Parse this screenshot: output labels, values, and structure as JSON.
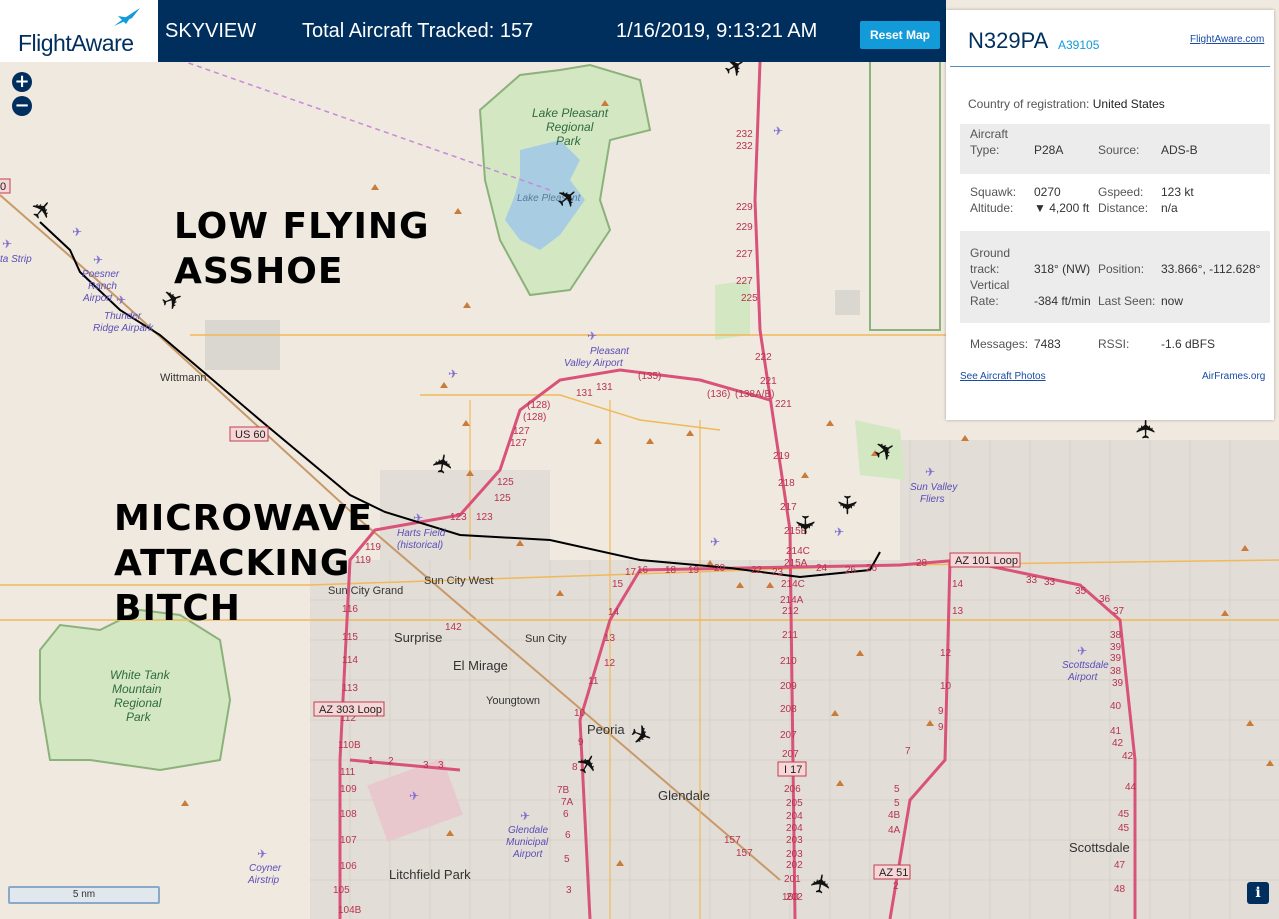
{
  "header": {
    "logo": "FlightAware",
    "title": "SKYVIEW",
    "aircraft_count": "Total Aircraft Tracked: 157",
    "datetime": "1/16/2019, 9:13:21 AM",
    "reset_label": "Reset Map"
  },
  "zoom": {
    "in": "+",
    "out": "−"
  },
  "panel": {
    "registration": "N329PA",
    "hex": "A39105",
    "fa_link": "FlightAware.com",
    "country_label": "Country of registration:",
    "country": "United States",
    "type_label_1": "Aircraft",
    "type_label_2": "Type:",
    "type": "P28A",
    "source_label": "Source:",
    "source": "ADS-B",
    "squawk_label": "Squawk:",
    "squawk": "0270",
    "gspeed_label": "Gspeed:",
    "gspeed": "123 kt",
    "altitude_label": "Altitude:",
    "altitude": "▼ 4,200 ft",
    "distance_label": "Distance:",
    "distance": "n/a",
    "track_label_1": "Ground",
    "track_label_2": "track:",
    "track": "318° (NW)",
    "position_label": "Position:",
    "position": "33.866°, -112.628°",
    "vrate_label_1": "Vertical",
    "vrate_label_2": "Rate:",
    "vrate": "-384 ft/min",
    "lastseen_label": "Last Seen:",
    "lastseen": "now",
    "messages_label": "Messages:",
    "messages": "7483",
    "rssi_label": "RSSI:",
    "rssi": "-1.6 dBFS",
    "photos_link": "See Aircraft Photos",
    "airframes_link": "AirFrames.org"
  },
  "annotations": {
    "low_1": "LOW FLYING",
    "low_2": "ASSHOE",
    "mw_1": "MICROWAVE",
    "mw_2": "ATTACKING",
    "mw_3": "BITCH"
  },
  "map_labels": {
    "lake": [
      "Lake Pleasant",
      "Regional",
      "Park"
    ],
    "lake_small": "Lake Pleasant",
    "poesner": [
      "Poesner",
      "Ranch",
      "Airport"
    ],
    "thunder": [
      "Thunder",
      "Ridge Airpark"
    ],
    "strip": "ta Strip",
    "wittmann": "Wittmann",
    "us60": "US 60",
    "pleasant_valley": [
      "Pleasant",
      "Valley Airport"
    ],
    "harts": [
      "Harts Field",
      "(historical)"
    ],
    "sun_city_west": "Sun City West",
    "sun_city_grand": "Sun City Grand",
    "surprise": "Surprise",
    "sun_city": "Sun City",
    "el_mirage": "El Mirage",
    "youngtown": "Youngtown",
    "peoria": "Peoria",
    "glendale": "Glendale",
    "glendale_airport": [
      "Glendale",
      "Municipal",
      "Airport"
    ],
    "white_tank": [
      "White Tank",
      "Mountain",
      "Regional",
      "Park"
    ],
    "az303": "AZ 303 Loop",
    "az101": "AZ 101 Loop",
    "i17": "I 17",
    "az51": "AZ 51",
    "coyner": [
      "Coyner",
      "Airstrip"
    ],
    "litchfield": "Litchfield Park",
    "scottsdale": "Scottsdale",
    "scottsdale_airport": [
      "Scottsdale",
      "Airport"
    ],
    "sun_valley": [
      "Sun Valley",
      "Fliers"
    ],
    "road_135": "(135)",
    "road_128": "(128)",
    "road_136": "(136)",
    "road_138": "(138A/B)",
    "route_zero": "0"
  },
  "scale": "5 nm",
  "info": "i",
  "colors": {
    "header_bg": "#002f5d",
    "accent": "#129bd8",
    "highway": "#d9527a",
    "track": "#000000",
    "land": "#efe9df",
    "water": "#a8cde3",
    "park": "#d4e7c3"
  }
}
